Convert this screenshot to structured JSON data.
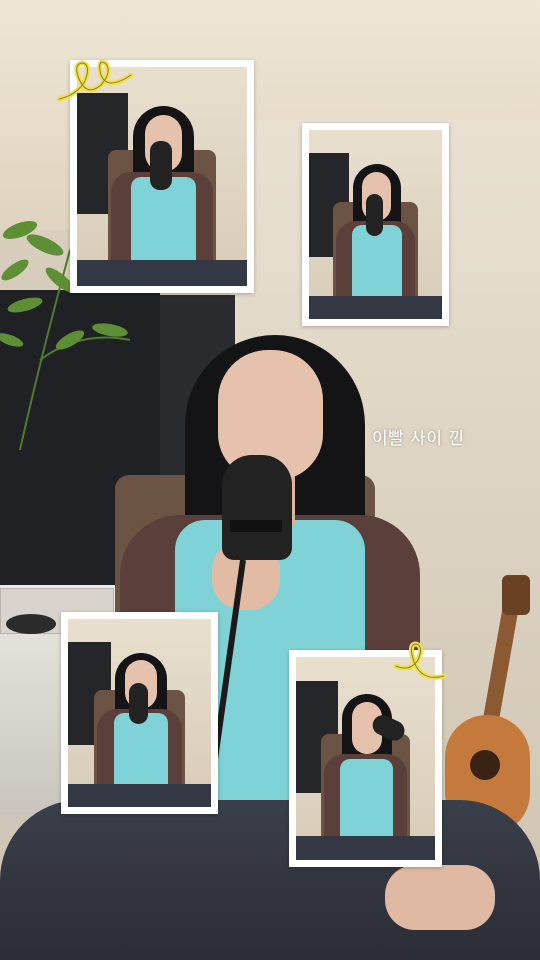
{
  "lyric": {
    "text": "이빨 사이 낀"
  },
  "colors": {
    "frame": "#ffffff",
    "accent_squiggle": "#f2e14a",
    "tee": "#7fd2d6",
    "shirt": "#5b3f3a",
    "hair": "#141416"
  },
  "insets": [
    {
      "name": "inset-photo-top-left"
    },
    {
      "name": "inset-photo-top-right"
    },
    {
      "name": "inset-photo-bottom-left"
    },
    {
      "name": "inset-photo-bottom-right"
    }
  ],
  "decorations": [
    {
      "icon": "yellow-squiggle-icon"
    },
    {
      "icon": "yellow-squiggle-icon"
    }
  ]
}
